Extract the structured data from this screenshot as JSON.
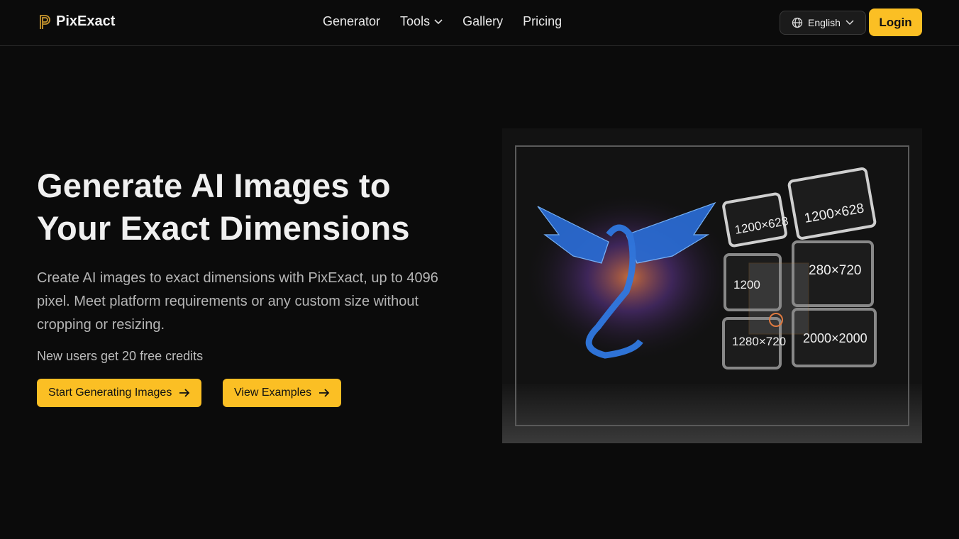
{
  "header": {
    "brand": "PixExact",
    "nav": [
      {
        "label": "Generator"
      },
      {
        "label": "Tools",
        "has_dropdown": true
      },
      {
        "label": "Gallery"
      },
      {
        "label": "Pricing"
      }
    ],
    "language": "English",
    "login": "Login"
  },
  "hero": {
    "title_line1": "Generate AI Images to",
    "title_line2": "Your Exact Dimensions",
    "description": "Create AI images to exact dimensions with PixExact, up to 4096 pixel. Meet platform requirements or any custom size without cropping or resizing.",
    "credits": "New users get 20 free credits",
    "primary_button": "Start Generating Images",
    "secondary_button": "View Examples",
    "image_labels": [
      "1200×628",
      "1200×628",
      "1200",
      "280×720",
      "1280×720",
      "2000×2000"
    ]
  },
  "colors": {
    "accent": "#fbbf24",
    "background": "#0b0b0b"
  }
}
